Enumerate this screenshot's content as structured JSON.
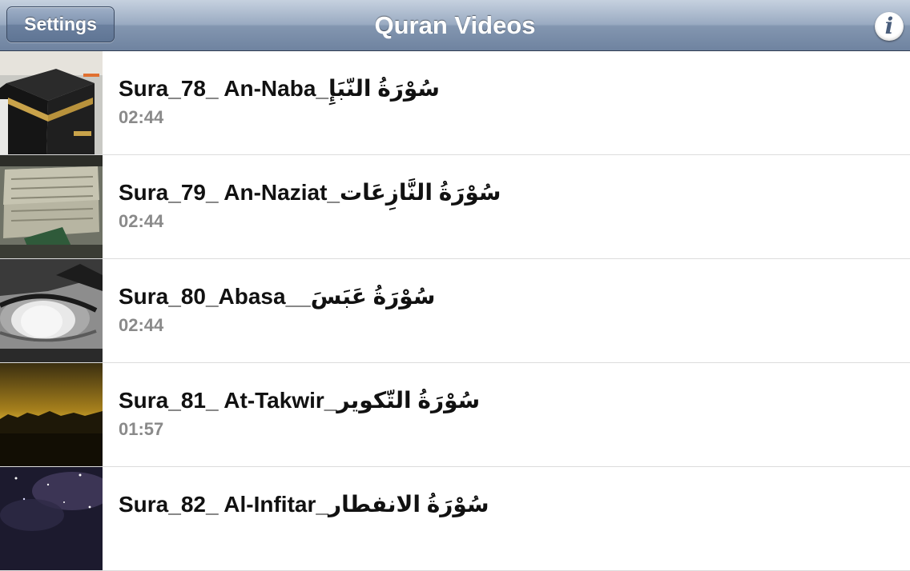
{
  "navbar": {
    "title": "Quran Videos",
    "settings_label": "Settings",
    "info_label": "i"
  },
  "videos": [
    {
      "title": "Sura_78_ An-Naba_سُوْرَةُ النّبَإِ",
      "duration": "02:44",
      "thumbnail": "kaaba"
    },
    {
      "title": "Sura_79_ An-Naziat_سُوْرَةُ النَّازِعَات",
      "duration": "02:44",
      "thumbnail": "quran-book"
    },
    {
      "title": "Sura_80_Abasa__سُوْرَةُ عَبَسَ",
      "duration": "02:44",
      "thumbnail": "eye"
    },
    {
      "title": "Sura_81_ At-Takwir_سُوْرَةُ التّكوير",
      "duration": "01:57",
      "thumbnail": "sunset"
    },
    {
      "title": "Sura_82_ Al-Infitar_سُوْرَةُ الانفطار",
      "duration": "",
      "thumbnail": "night-sky"
    }
  ],
  "colors": {
    "navbar": "#8396b0",
    "title_text": "#111111",
    "duration_text": "#8a8a8a"
  }
}
